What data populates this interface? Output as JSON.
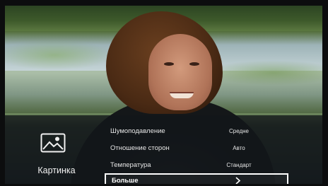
{
  "category": {
    "icon": "picture-icon",
    "label": "Картинка"
  },
  "menu": {
    "items": [
      {
        "label": "Шумоподавление",
        "value": "Средне"
      },
      {
        "label": "Отношение сторон",
        "value": "Авто"
      },
      {
        "label": "Температура",
        "value": "Стандарт"
      },
      {
        "label": "Больше",
        "value": "",
        "selected": true,
        "icon": "chevron-right-icon"
      }
    ]
  },
  "colors": {
    "overlay": "#12161a",
    "text": "#e6e6e6",
    "focus_border": "#ffffff"
  }
}
